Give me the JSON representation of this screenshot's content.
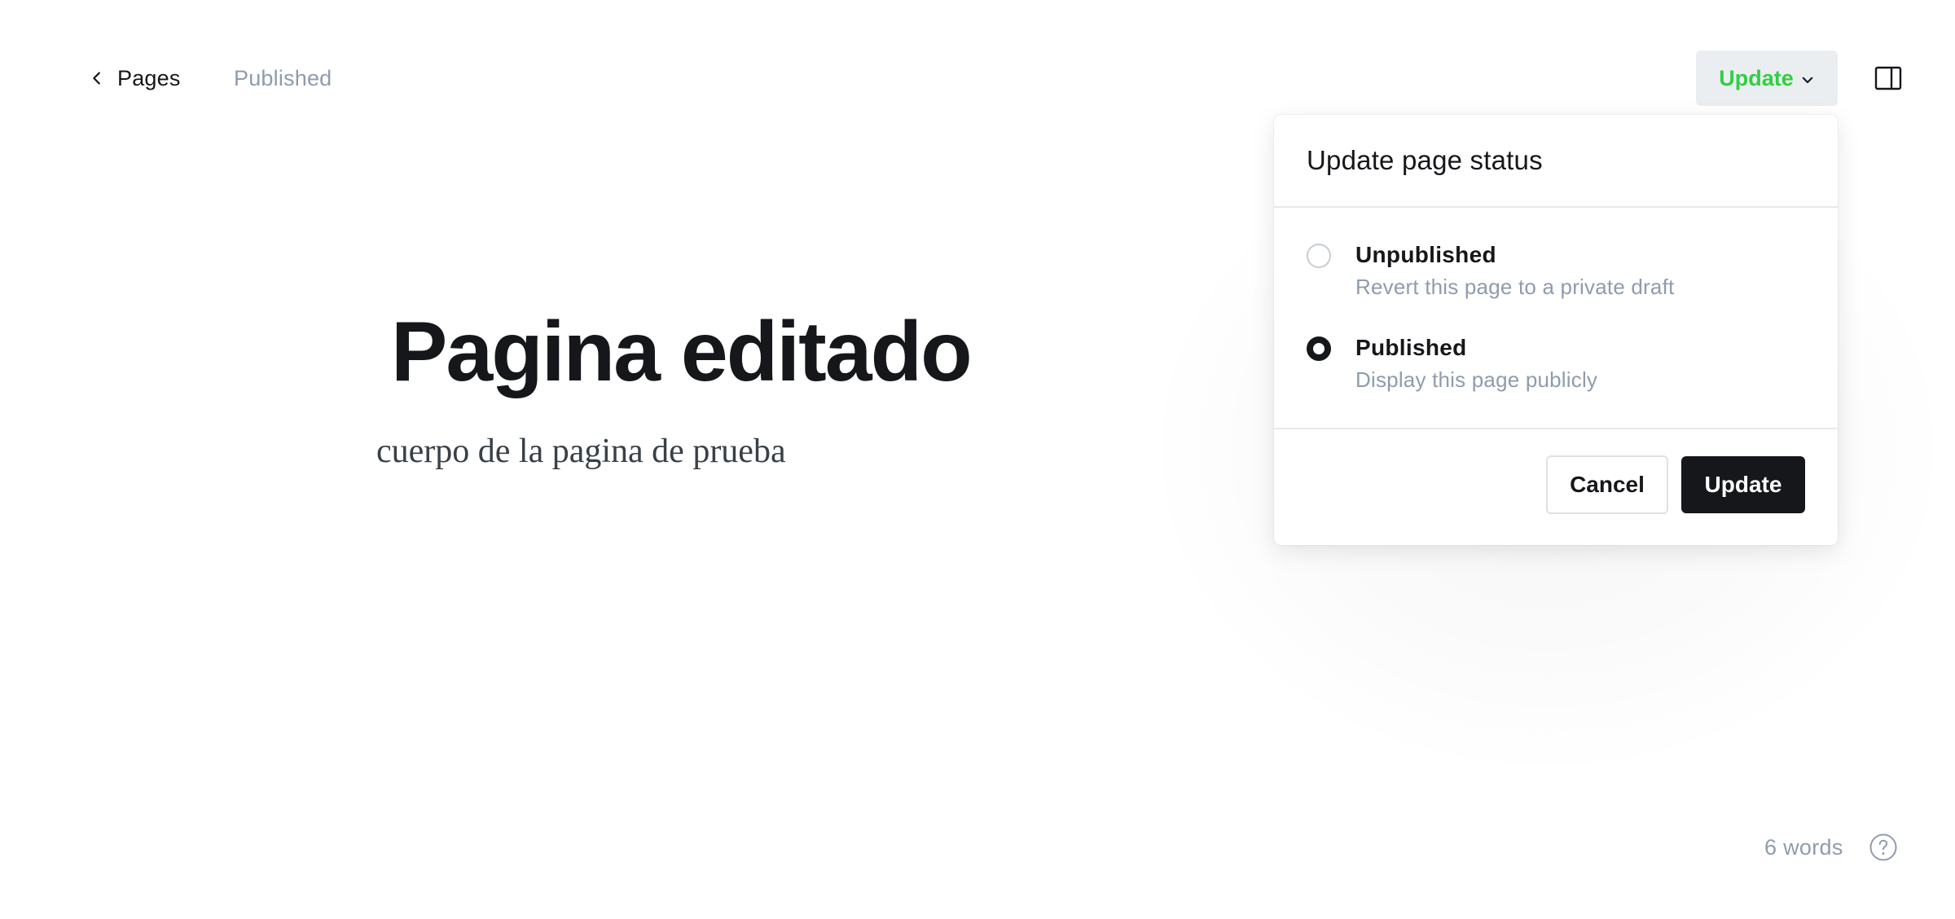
{
  "header": {
    "back_label": "Pages",
    "post_status": "Published",
    "update_trigger_label": "Update",
    "accent_color": "#30cf43"
  },
  "editor": {
    "title": "Pagina editado",
    "body": "cuerpo de la pagina de prueba"
  },
  "popover": {
    "title": "Update page status",
    "options": [
      {
        "label": "Unpublished",
        "description": "Revert this page to a private draft",
        "selected": false
      },
      {
        "label": "Published",
        "description": "Display this page publicly",
        "selected": true
      }
    ],
    "cancel_label": "Cancel",
    "confirm_label": "Update"
  },
  "footer": {
    "word_count": "6 words"
  },
  "icons": {
    "back": "chevron-left-icon",
    "dropdown": "chevron-down-icon",
    "sidebar": "sidebar-panel-icon",
    "help": "question-circle-icon"
  }
}
